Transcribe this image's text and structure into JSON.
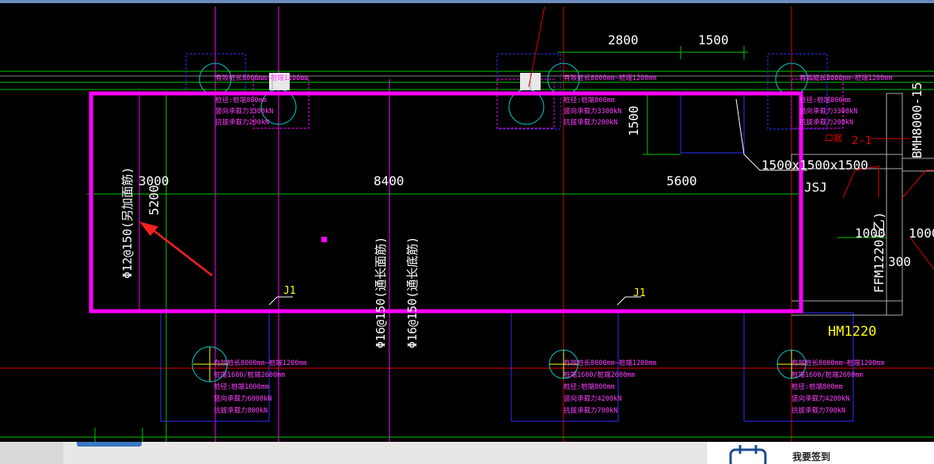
{
  "drawing": {
    "dims": {
      "d2800": "2800",
      "d1500_top": "1500",
      "d1500_vert": "1500",
      "d3000": "3000",
      "d5200": "5200",
      "d8400": "8400",
      "d5600": "5600",
      "d1000_a": "1000",
      "d1000_b": "1000",
      "d300": "300"
    },
    "labels": {
      "rebar_left": "Φ12@150(另加面筋)",
      "rebar_top_long": "Φ16@150(通长面筋)",
      "rebar_bottom_long": "Φ16@150(通长底筋)",
      "j1_left": "J1",
      "j1_right": "J1",
      "pit_size": "1500x1500x1500",
      "jsj": "JSJ",
      "hm1220": "HM1220",
      "fm1220": "FFM1220(乙)",
      "bmh": "BMH8000-15",
      "section": "2-1",
      "red_small": "口据"
    },
    "piles": {
      "top_left": [
        "有效桩长8000mm~桩端1200mm",
        "桩径:桩端800mm",
        "竖向承载力3300kN",
        "抗拔承载力200kN"
      ],
      "top_mid": [
        "有效桩长8000mm~桩端1200mm",
        "桩径:桩端800mm",
        "竖向承载力3300kN",
        "抗拔承载力200kN"
      ],
      "top_right": [
        "有效桩长8000mm~桩端1200mm",
        "桩径:桩端800mm",
        "竖向承载力3300kN",
        "抗拔承载力200kN"
      ],
      "bottom_left": [
        "有效桩长8000mm~桩端1200mm",
        "桩端1600/桩端2600mm",
        "桩径:桩端1000mm",
        "竖向承载力6000kN",
        "抗拔承载力800kN"
      ],
      "bottom_mid": [
        "有效桩长8000mm~桩端1200mm",
        "桩端1600/桩端2600mm",
        "桩径:桩端800mm",
        "竖向承载力4200kN",
        "抗拔承载力700kN"
      ],
      "bottom_right": [
        "有效桩长8000mm~桩端1200mm",
        "桩端1600/桩端2600mm",
        "桩径:桩端800mm",
        "竖向承载力4200kN",
        "抗拔承载力700kN"
      ]
    }
  },
  "footer": {
    "signin_label": "我要签到"
  },
  "colors": {
    "magenta": "#ff00ff",
    "green": "#00c800",
    "red": "#e00000",
    "white": "#ffffff",
    "yellow": "#ffff00",
    "blue": "#3030ff",
    "cyan": "#00ffff"
  }
}
